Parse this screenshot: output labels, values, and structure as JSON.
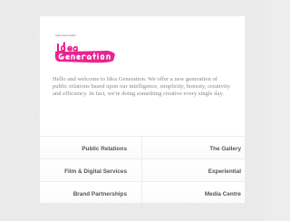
{
  "header": {
    "tagline": "Idea Generation"
  },
  "logo": {
    "text": "Idea Generation",
    "color": "#e8178a"
  },
  "intro": {
    "text": "Hello and welcome to Idea Generation. We offer a new generation of public relations based upon our intelligence, simplicity, honesty, creativity and efficiency. In fact, we're doing something creative every single day."
  },
  "menu": {
    "items": [
      {
        "label": "Public Relations"
      },
      {
        "label": "The Gallery"
      },
      {
        "label": "Film & Digital Services"
      },
      {
        "label": "Experiential"
      },
      {
        "label": "Brand Partnerships"
      },
      {
        "label": "Media Centre"
      }
    ]
  },
  "colors": {
    "accent": "#e8178a",
    "background": "#ececec",
    "text": "#555555"
  }
}
